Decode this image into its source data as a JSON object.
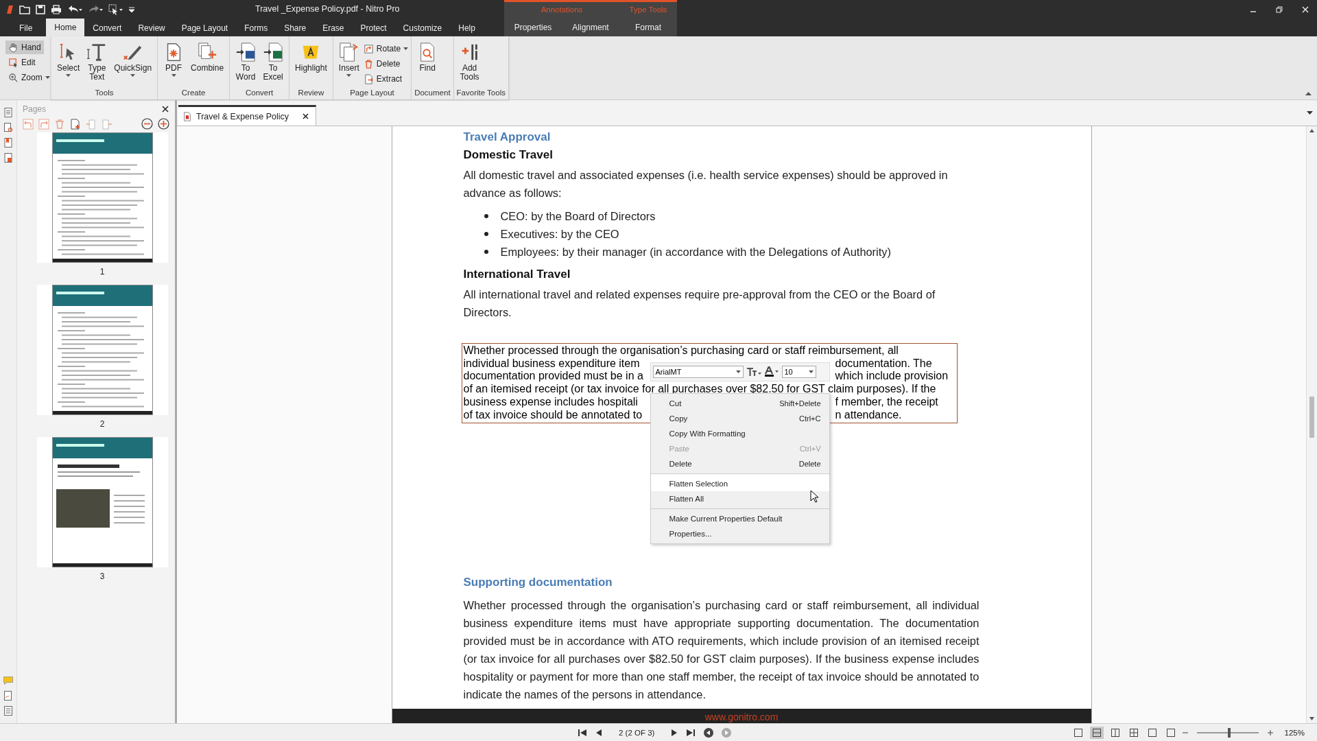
{
  "window": {
    "title": "Travel _Expense Policy.pdf - Nitro Pro"
  },
  "ribbon_tabs": [
    {
      "label": "File",
      "selected": false
    },
    {
      "label": "Home",
      "selected": true
    },
    {
      "label": "Convert",
      "selected": false
    },
    {
      "label": "Review",
      "selected": false
    },
    {
      "label": "Page Layout",
      "selected": false
    },
    {
      "label": "Forms",
      "selected": false
    },
    {
      "label": "Share",
      "selected": false
    },
    {
      "label": "Erase",
      "selected": false
    },
    {
      "label": "Protect",
      "selected": false
    },
    {
      "label": "Customize",
      "selected": false
    },
    {
      "label": "Help",
      "selected": false
    }
  ],
  "contextual_groups": [
    {
      "label": "Annotations",
      "tabs": [
        {
          "label": "Properties",
          "selected": false
        },
        {
          "label": "Alignment",
          "selected": false
        }
      ]
    },
    {
      "label": "Type Tools",
      "tabs": [
        {
          "label": "Format",
          "selected": false
        }
      ]
    }
  ],
  "mode_tools": [
    {
      "label": "Hand",
      "selected": true,
      "has_menu": false
    },
    {
      "label": "Edit",
      "selected": false,
      "has_menu": false
    },
    {
      "label": "Zoom",
      "selected": false,
      "has_menu": true
    }
  ],
  "ribbon_groups": [
    {
      "label": "Tools",
      "buttons": [
        {
          "label": "Select",
          "has_menu": true
        },
        {
          "label": "Type Text",
          "has_menu": false
        },
        {
          "label": "QuickSign",
          "has_menu": true
        }
      ]
    },
    {
      "label": "Create",
      "buttons": [
        {
          "label": "PDF",
          "has_menu": true
        },
        {
          "label": "Combine",
          "has_menu": false
        }
      ]
    },
    {
      "label": "Convert",
      "buttons": [
        {
          "label": "To Word",
          "has_menu": false
        },
        {
          "label": "To Excel",
          "has_menu": false
        }
      ]
    },
    {
      "label": "Review",
      "buttons": [
        {
          "label": "Highlight",
          "has_menu": false
        }
      ]
    },
    {
      "label": "Page Layout",
      "buttons": [
        {
          "label": "Insert",
          "has_menu": true
        }
      ],
      "small_buttons": [
        {
          "label": "Rotate",
          "has_menu": true
        },
        {
          "label": "Delete",
          "has_menu": false
        },
        {
          "label": "Extract",
          "has_menu": false
        }
      ]
    },
    {
      "label": "Document",
      "buttons": [
        {
          "label": "Find",
          "has_menu": false
        }
      ]
    },
    {
      "label": "Favorite Tools",
      "buttons": [
        {
          "label": "Add Tools",
          "has_menu": false
        }
      ]
    }
  ],
  "pages_panel": {
    "title": "Pages",
    "thumbnails": [
      {
        "label": "1",
        "kind": "text"
      },
      {
        "label": "2",
        "kind": "text"
      },
      {
        "label": "3",
        "kind": "photo"
      }
    ]
  },
  "document_tab": {
    "label": "Travel & Expense Policy",
    "selected": true
  },
  "page": {
    "blocks": [
      {
        "kind": "section",
        "text": "Travel Approval"
      },
      {
        "kind": "heading",
        "text": "Domestic Travel"
      },
      {
        "kind": "paragraph",
        "text": "All domestic travel and associated expenses (i.e. health service expenses) should be approved in advance as follows:"
      },
      {
        "kind": "bullets",
        "items": [
          "CEO: by the Board of Directors",
          "Executives: by the CEO",
          "Employees: by their manager (in accordance with the Delegations of Authority)"
        ]
      },
      {
        "kind": "heading",
        "text": "International Travel"
      },
      {
        "kind": "paragraph",
        "text": "All international travel and related expenses require pre-approval from the CEO or the Board of Directors."
      }
    ],
    "text_box": {
      "lines": [
        [
          "Whether processed through the organisation’s purchasing card or staff reimbursement, all"
        ],
        [
          "individual business expenditure item",
          "documentation. The"
        ],
        [
          "documentation provided must be in a",
          "which include provision"
        ],
        [
          "of an itemised receipt (or tax invoice for all purchases over $82.50 for GST claim purposes). If the"
        ],
        [
          "business expense includes hospitali",
          "f member, the receipt"
        ],
        [
          "of tax invoice should be annotated to",
          "n attendance."
        ]
      ]
    },
    "after_blocks": [
      {
        "kind": "section",
        "text": "Supporting documentation"
      },
      {
        "kind": "justified",
        "text": "Whether processed through the organisation’s purchasing card or staff reimbursement, all individual business expenditure items must have appropriate supporting documentation. The documentation provided must be in accordance with ATO requirements, which include provision of an itemised receipt (or tax invoice for all purchases over $82.50 for GST claim purposes). If the business expense includes hospitality or payment for more than one staff member, the receipt of tax invoice should be annotated to indicate the names of the persons in attendance."
      }
    ],
    "footer": "www.gonitro.com"
  },
  "mini_toolbar": {
    "font": "ArialMT",
    "size": "10"
  },
  "context_menu": [
    {
      "label": "Cut",
      "shortcut": "Shift+Delete",
      "disabled": false,
      "selected": false,
      "separator_before": false
    },
    {
      "label": "Copy",
      "shortcut": "Ctrl+C",
      "disabled": false,
      "selected": false,
      "separator_before": false
    },
    {
      "label": "Copy With Formatting",
      "disabled": false,
      "selected": false,
      "separator_before": false
    },
    {
      "label": "Paste",
      "shortcut": "Ctrl+V",
      "disabled": true,
      "selected": false,
      "separator_before": false
    },
    {
      "label": "Delete",
      "shortcut": "Delete",
      "disabled": false,
      "selected": false,
      "separator_before": false
    },
    {
      "label": "Flatten Selection",
      "disabled": false,
      "selected": true,
      "separator_before": true
    },
    {
      "label": "Flatten All",
      "disabled": false,
      "selected": false,
      "separator_before": false
    },
    {
      "label": "Make Current Properties Default",
      "disabled": false,
      "selected": false,
      "separator_before": true
    },
    {
      "label": "Properties...",
      "disabled": false,
      "selected": false,
      "separator_before": false
    }
  ],
  "status_bar": {
    "page_indicator": "2 (2 OF 3)",
    "views": [
      {
        "selected": false
      },
      {
        "selected": true
      },
      {
        "selected": false
      },
      {
        "selected": false
      },
      {
        "selected": false
      },
      {
        "selected": false
      }
    ],
    "zoom": {
      "level": 0.53,
      "reading": "125%"
    }
  }
}
